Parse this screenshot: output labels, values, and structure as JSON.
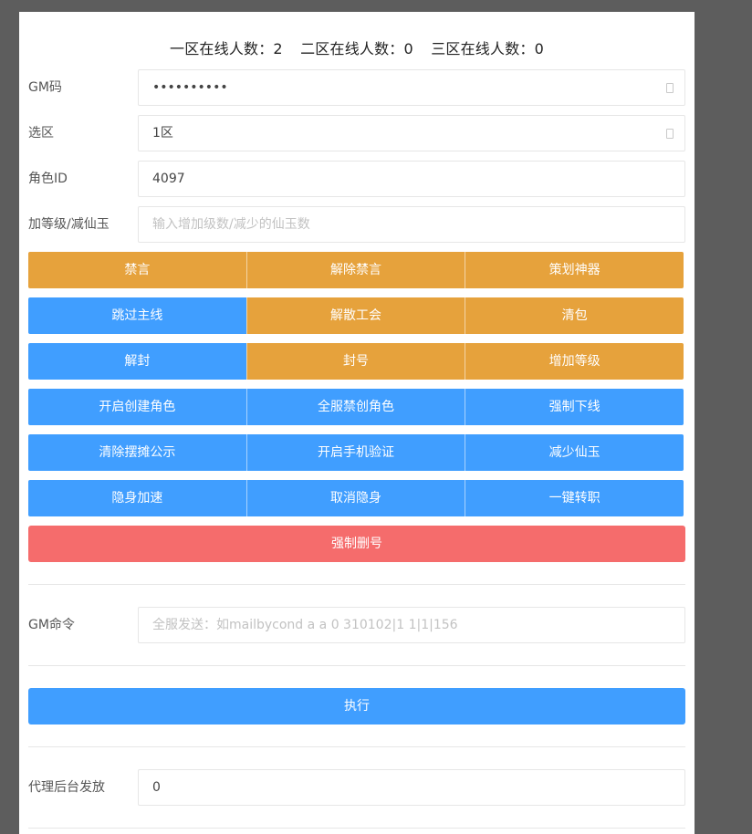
{
  "online": {
    "zone1": "一区在线人数：2",
    "zone2": "二区在线人数：0",
    "zone3": "三区在线人数：0"
  },
  "form": {
    "gm_code": {
      "label": "GM码",
      "value": "••••••••••"
    },
    "zone": {
      "label": "选区",
      "value": "1区"
    },
    "role_id": {
      "label": "角色ID",
      "value": "4097"
    },
    "level": {
      "label": "加等级/减仙玉",
      "placeholder": "输入增加级数/减少的仙玉数"
    }
  },
  "buttons": {
    "r1": [
      "禁言",
      "解除禁言",
      "策划神器"
    ],
    "r2": [
      "跳过主线",
      "解散工会",
      "清包"
    ],
    "r3": [
      "解封",
      "封号",
      "增加等级"
    ],
    "r4": [
      "开启创建角色",
      "全服禁创角色",
      "强制下线"
    ],
    "r5": [
      "清除摆摊公示",
      "开启手机验证",
      "减少仙玉"
    ],
    "r6": [
      "隐身加速",
      "取消隐身",
      "一键转职"
    ],
    "force_delete": "强制删号"
  },
  "gm_command": {
    "label": "GM命令",
    "placeholder": "全服发送：如mailbycond a a  0 310102|1 1|1|156",
    "execute": "执行"
  },
  "agent": {
    "label": "代理后台发放",
    "value": "0"
  },
  "colors": {
    "orange": "#e6a23c",
    "blue": "#409eff",
    "red": "#f56c6c"
  }
}
